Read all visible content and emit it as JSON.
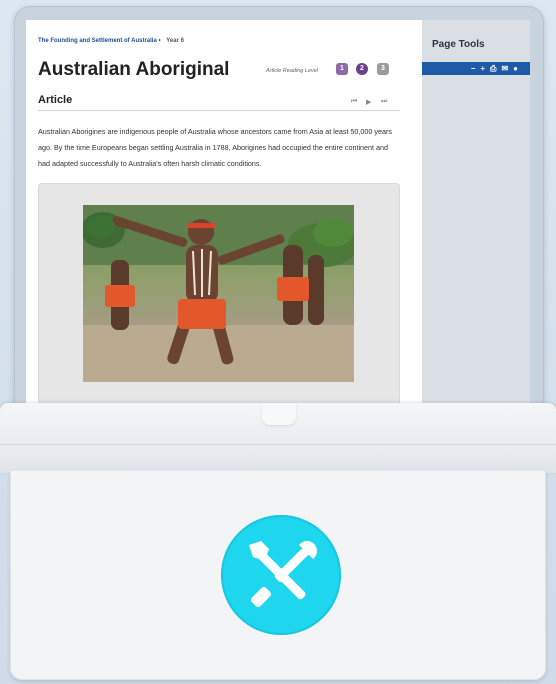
{
  "breadcrumb": {
    "course": "The Founding and Settlement of Australia",
    "separator": "•",
    "year": "Year 6"
  },
  "page_title": "Australian Aboriginal",
  "reading_level": {
    "label": "Article Reading Level",
    "levels": [
      "1",
      "2",
      "3"
    ],
    "selected": "2",
    "colors": {
      "inactive": "#8e6aa6",
      "active": "#6b3f8c",
      "disabled": "#9a9a9a"
    }
  },
  "section": {
    "title": "Article"
  },
  "audio_controls": {
    "icons": [
      "skip-back-icon",
      "play-icon",
      "skip-forward-icon"
    ],
    "glyphs": [
      "⏮",
      "▶",
      "⏭"
    ]
  },
  "article": {
    "text": "Australian Aborigines are indigenous people of Australia whose ancestors came from Asia at least 50,000 years ago. By the time Europeans began settling Australia in 1788, Aborigines had occupied the entire continent and had adapted successfully to Australia's often harsh climatic conditions."
  },
  "page_tools": {
    "title": "Page Tools",
    "tools": [
      {
        "icon": "zoom-out-icon",
        "glyph": "−"
      },
      {
        "icon": "zoom-in-icon",
        "glyph": "+"
      },
      {
        "icon": "print-icon",
        "glyph": "⎙"
      },
      {
        "icon": "email-icon",
        "glyph": "✉"
      },
      {
        "icon": "globe-icon",
        "glyph": "●"
      }
    ],
    "bar_color": "#1e5aa8"
  },
  "badge": {
    "icon": "wrench-screwdriver-icon",
    "color": "#1fd6ef"
  }
}
